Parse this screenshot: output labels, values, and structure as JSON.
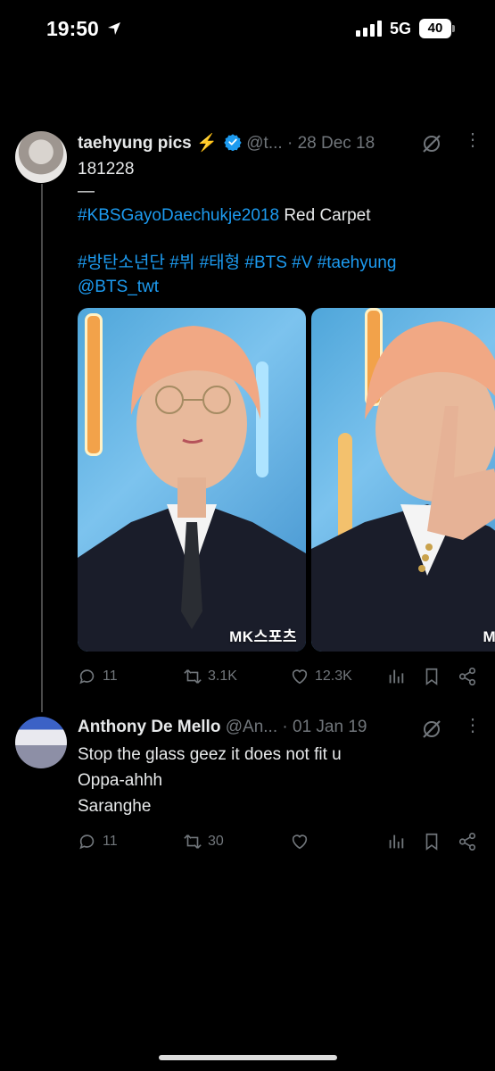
{
  "status_bar": {
    "time": "19:50",
    "network": "5G",
    "battery": "40",
    "location_icon": "location-arrow-icon",
    "signal_icon": "signal-bars-icon"
  },
  "tweets": [
    {
      "display_name": "taehyung pics",
      "emoji": "⚡",
      "handle": "@t...",
      "separator": "·",
      "date": "28 Dec 18",
      "verified": true,
      "lines": {
        "l1": "181228",
        "l2": "—",
        "l3_link": "#KBSGayoDaechukje2018",
        "l3_text": " Red Carpet",
        "l4": "#방탄소년단 #뷔 #태형 #BTS #V #taehyung",
        "l5": "@BTS_twt"
      },
      "media_watermark_1": "MK스포츠",
      "media_watermark_2": "MK",
      "stats": {
        "replies": "11",
        "reposts": "3.1K",
        "likes": "12.3K"
      }
    },
    {
      "display_name": "Anthony De Mello",
      "handle": "@An...",
      "separator": "·",
      "date": "01 Jan 19",
      "lines": {
        "l1": "Stop the glass geez it does not fit u",
        "l2": "Oppa-ahhh",
        "l3": "Saranghe"
      },
      "stats": {
        "replies": "11",
        "reposts": "30",
        "likes": ""
      }
    }
  ],
  "colors": {
    "background": "#000000",
    "text": "#e7e9ea",
    "muted": "#71767b",
    "link": "#1d9bf0",
    "verified": "#1d9bf0",
    "bolt": "#f5b400"
  }
}
